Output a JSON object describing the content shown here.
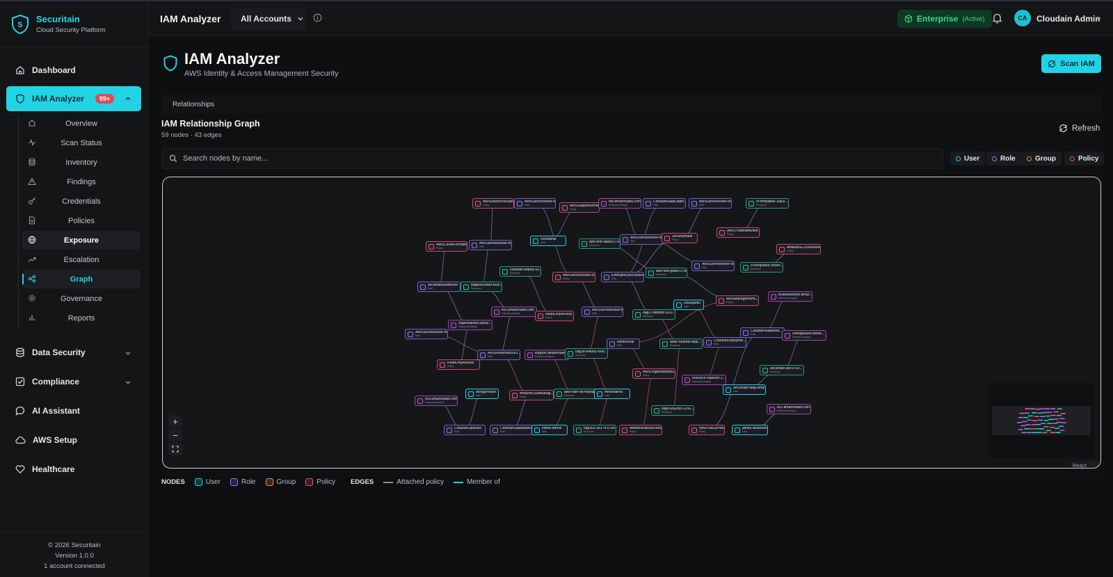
{
  "app": {
    "brand_name": "Securitain",
    "brand_tagline": "Cloud Security Platform",
    "header_title": "IAM Analyzer",
    "account_selector": "All Accounts",
    "plan_label": "Enterprise",
    "plan_status": "(Active)",
    "user_initials": "CA",
    "user_name": "Cloudain Admin"
  },
  "sidebar": {
    "dashboard": "Dashboard",
    "iam_analyzer": "IAM Analyzer",
    "iam_badge": "99+",
    "sub_items": [
      "Overview",
      "Scan Status",
      "Inventory",
      "Findings",
      "Credentials",
      "Policies",
      "Exposure",
      "Escalation",
      "Graph",
      "Governance",
      "Reports"
    ],
    "data_security": "Data Security",
    "compliance": "Compliance",
    "ai_assistant": "AI Assistant",
    "aws_setup": "AWS Setup",
    "healthcare": "Healthcare",
    "footer_copyright": "© 2026 Securitain",
    "footer_version": "Version 1.0.0",
    "footer_accounts": "1 account connected"
  },
  "page": {
    "title": "IAM Analyzer",
    "subtitle": "AWS Identity & Access Management Security",
    "scan_button": "Scan IAM",
    "tab": "Relationships",
    "graph_title": "IAM Relationship Graph",
    "graph_counts": "59 nodes · 43 edges",
    "refresh": "Refresh",
    "search_placeholder": "Search nodes by name...",
    "filters": [
      {
        "label": "User",
        "color": "#22d3e6"
      },
      {
        "label": "Role",
        "color": "#8b7cf6"
      },
      {
        "label": "Group",
        "color": "#f08a3c"
      },
      {
        "label": "Policy",
        "color": "#f0557a"
      }
    ],
    "react_flow_label": "React Flow"
  },
  "graph_nodes": [
    {
      "name": "AWSResourceExplor...",
      "sub": "Policy",
      "type": "policy"
    },
    {
      "name": "AWSServiceRoleFor...",
      "sub": "Role",
      "type": "role"
    },
    {
      "name": "AWSSupportServic...",
      "sub": "Policy",
      "type": "policy"
    },
    {
      "name": "rds.amazonaws.com",
      "sub": "External principal",
      "type": "external"
    },
    {
      "name": "CloudainSaasDeplo...",
      "sub": "Role",
      "type": "role"
    },
    {
      "name": "AWSServiceRoleFor...",
      "sub": "Role",
      "type": "role"
    },
    {
      "name": "cf-templates-16p3l...",
      "sub": "Resource",
      "type": "resource"
    },
    {
      "name": "AWSCloudFormation...",
      "sub": "Policy",
      "type": "policy"
    },
    {
      "name": "AWSServiceRoleFor...",
      "sub": "Role",
      "type": "role"
    },
    {
      "name": "cloudainai",
      "sub": "User",
      "type": "user"
    },
    {
      "name": "aws-test-saas6-0760...",
      "sub": "Resource",
      "type": "resource"
    },
    {
      "name": "AWSServiceRoleFor...",
      "sub": "Role",
      "type": "role"
    },
    {
      "name": "SecurityAudit",
      "sub": "Policy",
      "type": "policy"
    },
    {
      "name": "AWSTrustedAdvisor...",
      "sub": "Policy",
      "type": "policy"
    },
    {
      "name": "AmazonECSServiceR...",
      "sub": "Policy",
      "type": "policy"
    },
    {
      "name": "cloudain-deploy-62...",
      "sub": "Resource",
      "type": "resource"
    },
    {
      "name": "AWSServiceRoleFor...",
      "sub": "Policy",
      "type": "policy"
    },
    {
      "name": "EmergencyAccessRole",
      "sub": "Role",
      "type": "role"
    },
    {
      "name": "aws-test-gaia6-0760...",
      "sub": "Resource",
      "type": "resource"
    },
    {
      "name": "AWSServiceRoleFor...",
      "sub": "Role",
      "type": "role"
    },
    {
      "name": "cf-templates-cn88h...",
      "sub": "Resource",
      "type": "resource"
    },
    {
      "name": "securitainAuditRole",
      "sub": "Role",
      "type": "role"
    },
    {
      "name": "bag88c0sb6b-fu0n...",
      "sub": "Resource",
      "type": "resource"
    },
    {
      "name": "trustedadvisor.amaz...",
      "sub": "External principal",
      "type": "external"
    },
    {
      "name": "AWSManagementC...",
      "sub": "Policy",
      "type": "policy"
    },
    {
      "name": "cloudsuffer",
      "sub": "User",
      "type": "user"
    },
    {
      "name": "ecs.amazonaws.com",
      "sub": "External principal",
      "type": "external"
    },
    {
      "name": "AWSServiceRoleFor...",
      "sub": "Role",
      "type": "role"
    },
    {
      "name": "bag270dbsfbc-f2c0...",
      "sub": "Resource",
      "type": "resource"
    },
    {
      "name": "ReadOnlyAccess",
      "sub": "Policy",
      "type": "policy"
    },
    {
      "name": "organizations.amaz...",
      "sub": "External principal",
      "type": "external"
    },
    {
      "name": "AWSServiceRoleFor...",
      "sub": "Role",
      "type": "role"
    },
    {
      "name": "CloudainSaasbeta...",
      "sub": "Role",
      "type": "role"
    },
    {
      "name": "cloudguruon-beme...",
      "sub": "External principal",
      "type": "external"
    },
    {
      "name": "AdminRole",
      "sub": "Role",
      "type": "role"
    },
    {
      "name": "CloudainDeployme...",
      "sub": "Role",
      "type": "role"
    },
    {
      "name": "AWSReservedSSO...",
      "sub": "Role",
      "type": "role"
    },
    {
      "name": "support.amazonaws...",
      "sub": "External principal",
      "type": "external"
    },
    {
      "name": "bag3b-b4i8dc-f66d...",
      "sub": "Resource",
      "type": "resource"
    },
    {
      "name": "aidar-runtime-depl...",
      "sub": "Resource",
      "type": "resource"
    },
    {
      "name": "ReadOnlyAccess",
      "sub": "Policy",
      "type": "policy"
    },
    {
      "name": "securitain-lab-0760...",
      "sub": "Resource",
      "type": "resource"
    },
    {
      "name": "AWSOrganizationsS...",
      "sub": "Policy",
      "type": "policy"
    },
    {
      "name": "resource-explorer-2...",
      "sub": "External principal",
      "type": "external"
    },
    {
      "name": "securitain-diag-temp",
      "sub": "User",
      "type": "user"
    },
    {
      "name": "sbxcjjohnson",
      "sub": "User",
      "type": "user"
    },
    {
      "name": "AmazonSSMManag...",
      "sub": "Policy",
      "type": "policy"
    },
    {
      "name": "aws-nam-d6-manag...",
      "sub": "Resource",
      "type": "resource"
    },
    {
      "name": "mikecallens",
      "sub": "User",
      "type": "user"
    },
    {
      "name": "ecs.amazonaws.com",
      "sub": "External principal",
      "type": "external"
    },
    {
      "name": "ec2.amazonaws.com",
      "sub": "External principal",
      "type": "external"
    },
    {
      "name": "bag41ea2f95-2256...",
      "sub": "Resource",
      "type": "resource"
    },
    {
      "name": "CloudainOpsRole",
      "sub": "Role",
      "type": "role"
    },
    {
      "name": "CloudainSaasbase0...",
      "sub": "Role",
      "type": "role"
    },
    {
      "name": "elbow-admin",
      "sub": "User",
      "type": "user"
    },
    {
      "name": "bag360-2b174-c784...",
      "sub": "Resource",
      "type": "resource"
    },
    {
      "name": "AdministratorAccess",
      "sub": "Policy",
      "type": "policy"
    },
    {
      "name": "WAFFullS3Policy",
      "sub": "Policy",
      "type": "policy"
    },
    {
      "name": "james.anderson",
      "sub": "User",
      "type": "user"
    }
  ],
  "legend": {
    "nodes_label": "NODES",
    "node_types": [
      {
        "label": "User",
        "color": "#22d3e6"
      },
      {
        "label": "Role",
        "color": "#8b7cf6"
      },
      {
        "label": "Group",
        "color": "#f08a3c"
      },
      {
        "label": "Policy",
        "color": "#f0557a"
      }
    ],
    "edges_label": "EDGES",
    "edge_types": [
      {
        "label": "Attached policy",
        "color": "#8a8f98"
      },
      {
        "label": "Member of",
        "color": "#22d3e6"
      }
    ]
  }
}
